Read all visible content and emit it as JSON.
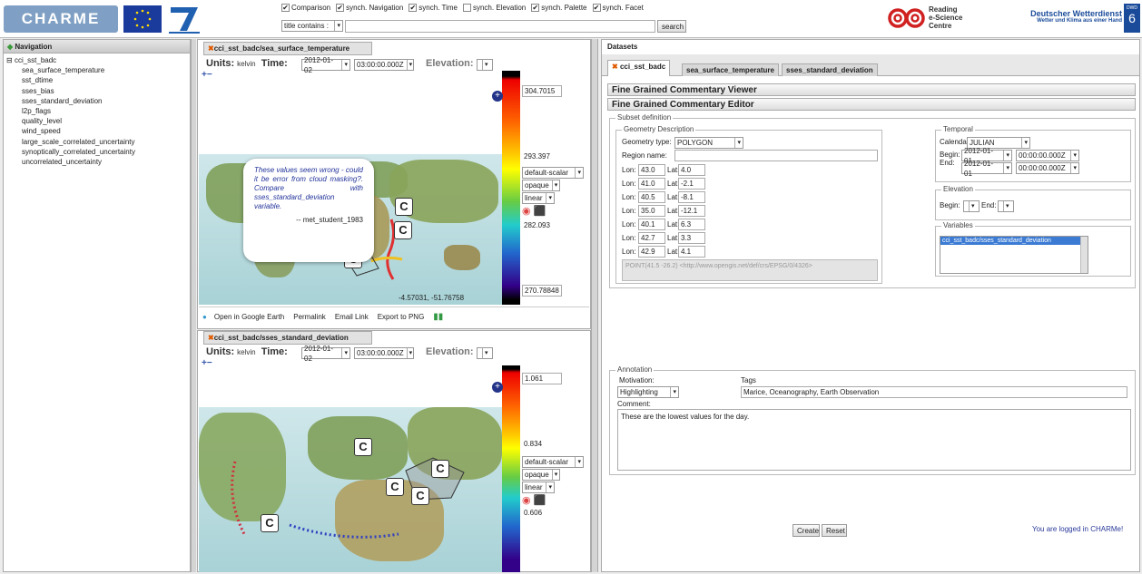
{
  "topbar": {
    "logo_text": "CHARME",
    "checkboxes": [
      {
        "label": "Comparison",
        "checked": true
      },
      {
        "label": "synch. Navigation",
        "checked": true
      },
      {
        "label": "synch. Time",
        "checked": true
      },
      {
        "label": "synch. Elevation",
        "checked": false
      },
      {
        "label": "synch. Palette",
        "checked": true
      },
      {
        "label": "synch. Facet",
        "checked": true
      }
    ],
    "filter_select": "title contains :",
    "search_value": "",
    "search_label": "search",
    "resc_name": "Reading e-Science Centre",
    "resc_line1": "Reading",
    "resc_line2": "e-Science",
    "resc_line3": "Centre",
    "dwd_name": "Deutscher Wetterdienst",
    "dwd_tagline": "Wetter und Klima aus einer Hand",
    "dwd_badge": "DWD"
  },
  "navigation": {
    "title": "Navigation",
    "root": "cci_sst_badc",
    "items": [
      "sea_surface_temperature",
      "sst_dtime",
      "sses_bias",
      "sses_standard_deviation",
      "l2p_flags",
      "quality_level",
      "wind_speed",
      "large_scale_correlated_uncertainty",
      "synoptically_correlated_uncertainty",
      "uncorrelated_uncertainty"
    ]
  },
  "map1": {
    "title": "cci_sst_badc/sea_surface_temperature",
    "units_label": "Units:",
    "units": "kelvin",
    "time_label": "Time:",
    "date": "2012-01-02",
    "time": "03:00:00.000Z",
    "elevation_label": "Elevation:",
    "colorbar_max": "304.7015",
    "colorbar_mid1": "293.397",
    "colorbar_mid2": "282.093",
    "colorbar_min": "270.78848",
    "palette": "default-scalar",
    "opacity": "opaque",
    "scale": "linear",
    "coords": "-4.57031, -51.76758",
    "comment_text": "These values seem wrong - could it be error from cloud masking?. Compare with sses_standard_deviation variable.",
    "comment_author": "-- met_student_1983",
    "links": [
      "Open in Google Earth",
      "Permalink",
      "Email Link",
      "Export to PNG"
    ]
  },
  "map2": {
    "title": "cci_sst_badc/sses_standard_deviation",
    "units_label": "Units:",
    "units": "kelvin",
    "time_label": "Time:",
    "date": "2012-01-02",
    "time": "03:00:00.000Z",
    "elevation_label": "Elevation:",
    "colorbar_max": "1.061",
    "colorbar_mid1": "0.834",
    "colorbar_mid2": "0.606",
    "palette": "default-scalar",
    "opacity": "opaque",
    "scale": "linear"
  },
  "marker_label": "C",
  "datasets": {
    "title": "Datasets",
    "tabs": [
      "cci_sst_badc",
      "sea_surface_temperature",
      "sses_standard_deviation"
    ],
    "viewer_title": "Fine Grained Commentary Viewer",
    "editor_title": "Fine Grained Commentary Editor",
    "subset_legend": "Subset definition",
    "geometry_legend": "Geometry Description",
    "geometry_type_label": "Geometry type:",
    "geometry_type": "POLYGON",
    "region_name_label": "Region name:",
    "region_name": "",
    "lon_label": "Lon:",
    "lat_label": "Lat:",
    "coords": [
      {
        "lon": "43.0",
        "lat": "4.0"
      },
      {
        "lon": "41.0",
        "lat": "-2.1"
      },
      {
        "lon": "40.5",
        "lat": "-8.1"
      },
      {
        "lon": "35.0",
        "lat": "-12.1"
      },
      {
        "lon": "40.1",
        "lat": "6.3"
      },
      {
        "lon": "42.7",
        "lat": "3.3"
      },
      {
        "lon": "42.9",
        "lat": "4.1"
      }
    ],
    "wkt": "POINT(41.5 -26.2) <http://www.opengis.net/def/crs/EPSG/0/4326>",
    "temporal_legend": "Temporal",
    "calendar_label": "Calendar:",
    "calendar": "JULIAN",
    "begin_label": "Begin:",
    "end_label": "End:",
    "begin_date": "2012-01-01",
    "begin_time": "00:00:00.000Z",
    "end_date": "2012-01-01",
    "end_time": "00:00:00.000Z",
    "elevation_legend": "Elevation",
    "elev_begin_label": "Begin:",
    "elev_end_label": "End:",
    "variables_legend": "Variables",
    "variable_selected": "cci_sst_badc/sses_standard_deviation",
    "annotation_legend": "Annotation",
    "motivation_label": "Motivation:",
    "motivation": "Highlighting",
    "tags_label": "Tags",
    "tags": "Marice, Oceanography, Earth Observation",
    "comment_label": "Comment:",
    "comment": "These are the lowest values for the day.",
    "create_label": "Create",
    "reset_label": "Reset",
    "login_status": "You are logged in CHARMe!"
  }
}
